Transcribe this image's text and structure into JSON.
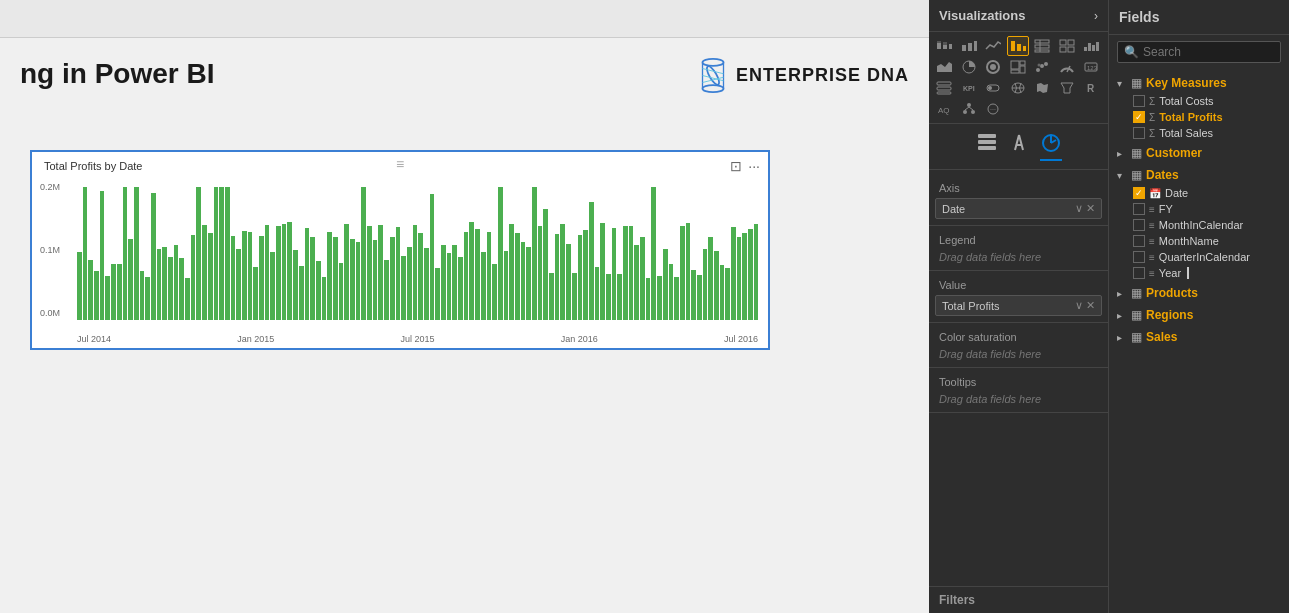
{
  "header": {
    "title": "ng in Power BI"
  },
  "logo": {
    "text": "ENTERPRISE DNA",
    "bold_part": "DNA"
  },
  "chart": {
    "title": "Total Profits by Date",
    "y_labels": [
      "0.2M",
      "0.1M",
      "0.0M"
    ],
    "x_labels": [
      "Jul 2014",
      "Jan 2015",
      "Jul 2015",
      "Jan 2016",
      "Jul 2016"
    ],
    "bar_count": 120
  },
  "visualizations": {
    "panel_title": "Visualizations",
    "sections": [
      {
        "id": "axis",
        "label": "Axis",
        "field": "Date",
        "placeholder": null
      },
      {
        "id": "legend",
        "label": "Legend",
        "field": null,
        "placeholder": "Drag data fields here"
      },
      {
        "id": "value",
        "label": "Value",
        "field": "Total Profits",
        "placeholder": null
      },
      {
        "id": "color_saturation",
        "label": "Color saturation",
        "field": null,
        "placeholder": "Drag data fields here"
      },
      {
        "id": "tooltips",
        "label": "Tooltips",
        "field": null,
        "placeholder": "Drag data fields here"
      }
    ]
  },
  "fields": {
    "panel_title": "Fields",
    "search_placeholder": "Search",
    "groups": [
      {
        "id": "key_measures",
        "name": "Key Measures",
        "icon": "table",
        "expanded": true,
        "items": [
          {
            "name": "Total Costs",
            "checked": false,
            "type": "sigma"
          },
          {
            "name": "Total Profits",
            "checked": true,
            "type": "sigma",
            "highlighted": true
          },
          {
            "name": "Total Sales",
            "checked": false,
            "type": "sigma"
          }
        ]
      },
      {
        "id": "customer",
        "name": "Customer",
        "icon": "table",
        "expanded": false,
        "items": []
      },
      {
        "id": "dates",
        "name": "Dates",
        "icon": "table",
        "expanded": true,
        "items": [
          {
            "name": "Date",
            "checked": true,
            "type": "calendar"
          },
          {
            "name": "FY",
            "checked": false,
            "type": "text"
          },
          {
            "name": "MonthInCalendar",
            "checked": false,
            "type": "text"
          },
          {
            "name": "MonthName",
            "checked": false,
            "type": "text"
          },
          {
            "name": "QuarterInCalendar",
            "checked": false,
            "type": "text"
          },
          {
            "name": "Year",
            "checked": false,
            "type": "text",
            "cursor": true
          }
        ]
      },
      {
        "id": "products",
        "name": "Products",
        "icon": "table",
        "expanded": false,
        "items": []
      },
      {
        "id": "regions",
        "name": "Regions",
        "icon": "table",
        "expanded": false,
        "items": []
      },
      {
        "id": "sales",
        "name": "Sales",
        "icon": "table",
        "expanded": false,
        "items": []
      }
    ]
  },
  "filters": {
    "label": "Filters"
  }
}
